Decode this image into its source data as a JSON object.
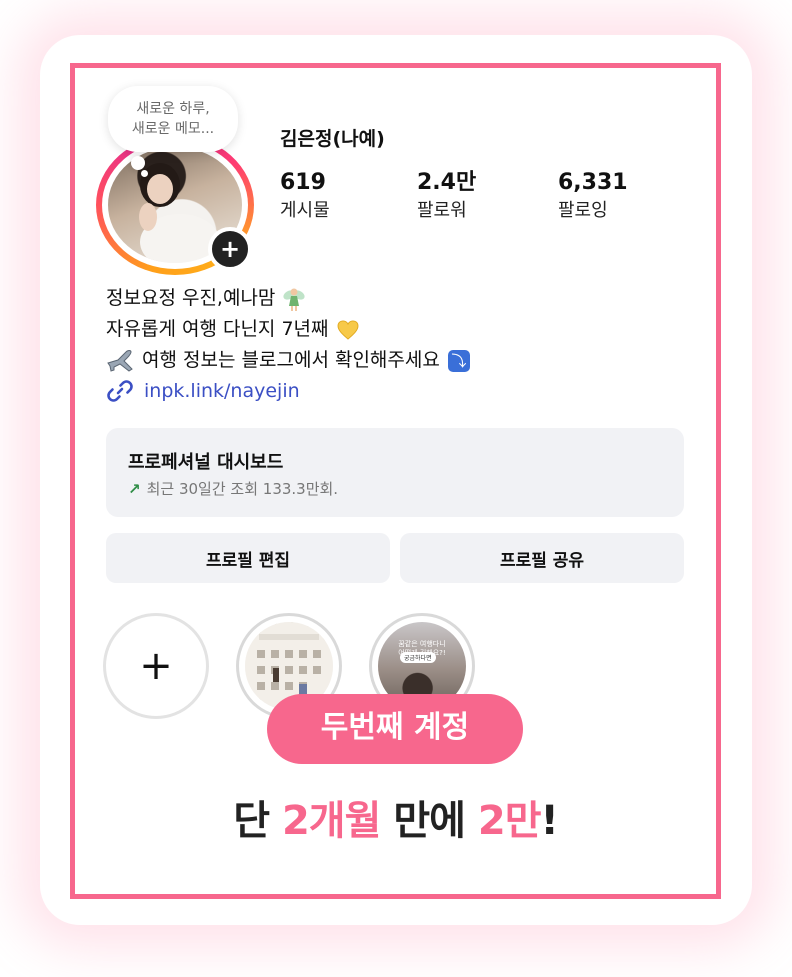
{
  "profile": {
    "note": [
      "새로운 하루,",
      "새로운 메모..."
    ],
    "username": "김은정(나예)",
    "stats": [
      {
        "value": "619",
        "label": "게시물"
      },
      {
        "value": "2.4만",
        "label": "팔로워"
      },
      {
        "value": "6,331",
        "label": "팔로잉"
      }
    ],
    "bio": {
      "line1": "정보요정 우진,예나맘",
      "line2": "자유롭게 여행 다닌지 7년째",
      "line3": "여행 정보는 블로그에서 확인해주세요"
    },
    "link": "inpk.link/nayejin"
  },
  "dashboard": {
    "title": "프로페셔널 대시보드",
    "subtitle": "최근 30일간 조회 133.3만회."
  },
  "buttons": {
    "edit_profile": "프로필 편집",
    "share_profile": "프로필 공유"
  },
  "highlights": {
    "new_symbol": "+",
    "item2_caption": [
      "꿈같은 여행다니",
      "어떻게 길해요?!"
    ],
    "item2_chip": "궁금하다면"
  },
  "banner": {
    "pill": "두번째 계정",
    "headline": [
      "단 ",
      "2개월",
      " 만에 ",
      "2만",
      "!"
    ]
  },
  "colors": {
    "accent_pink": "#f7678d",
    "link_blue": "#3b4fc4",
    "trend_green": "#2f8d46"
  }
}
